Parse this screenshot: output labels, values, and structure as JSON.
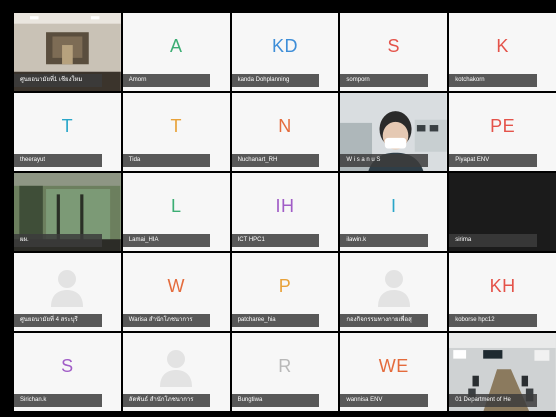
{
  "participants": [
    {
      "name": "ศูนยอนามัยที่1 เชียงใหม",
      "initials": "",
      "color": "",
      "kind": "video-room"
    },
    {
      "name": "Amorn",
      "initials": "A",
      "color": "#3cae74",
      "kind": "initials"
    },
    {
      "name": "kanda Dohplanning",
      "initials": "KD",
      "color": "#3e8ed8",
      "kind": "initials"
    },
    {
      "name": "somporn",
      "initials": "S",
      "color": "#e4534a",
      "kind": "initials"
    },
    {
      "name": "kotchakorn",
      "initials": "K",
      "color": "#e4534a",
      "kind": "initials"
    },
    {
      "name": "theerayut",
      "initials": "T",
      "color": "#2aa6c9",
      "kind": "initials"
    },
    {
      "name": "Tida",
      "initials": "T",
      "color": "#e8a23a",
      "kind": "initials"
    },
    {
      "name": "Nuchanart_RH",
      "initials": "N",
      "color": "#e46b3c",
      "kind": "initials"
    },
    {
      "name": "W i s a n u  S",
      "initials": "",
      "color": "",
      "kind": "video-person"
    },
    {
      "name": "Piyapat ENV",
      "initials": "PE",
      "color": "#e4534a",
      "kind": "initials"
    },
    {
      "name": "ผผ.",
      "initials": "",
      "color": "",
      "kind": "video-corridor"
    },
    {
      "name": "Lamai_HIA",
      "initials": "L",
      "color": "#3cae74",
      "kind": "initials"
    },
    {
      "name": "ICT HPC1",
      "initials": "IH",
      "color": "#a15dc7",
      "kind": "initials"
    },
    {
      "name": "ilawin.k",
      "initials": "I",
      "color": "#2aa6c9",
      "kind": "initials"
    },
    {
      "name": "sirima",
      "initials": "",
      "color": "",
      "kind": "blank"
    },
    {
      "name": "ศูนยอนามัยที่ 4 สระบุรี",
      "initials": "",
      "color": "",
      "kind": "avatar"
    },
    {
      "name": "Warisa สำนักโภชนาการ",
      "initials": "W",
      "color": "#e46b3c",
      "kind": "initials"
    },
    {
      "name": "patcharee_hia",
      "initials": "P",
      "color": "#e8a23a",
      "kind": "initials"
    },
    {
      "name": "กองกิจกรรมทางกายเพื่อสุ",
      "initials": "",
      "color": "",
      "kind": "avatar"
    },
    {
      "name": "koborse hpc12",
      "initials": "KH",
      "color": "#e4534a",
      "kind": "initials"
    },
    {
      "name": "Sirichan.k",
      "initials": "S",
      "color": "#a15dc7",
      "kind": "initials"
    },
    {
      "name": "ลัดพันธ์ สำนักโภชนาการ",
      "initials": "",
      "color": "",
      "kind": "avatar"
    },
    {
      "name": "Bungtiwa",
      "initials": "R",
      "color": "#b8b8b8",
      "kind": "initials"
    },
    {
      "name": "wannisa ENV",
      "initials": "WE",
      "color": "#e46b3c",
      "kind": "initials"
    },
    {
      "name": "01 Department of He",
      "initials": "",
      "color": "",
      "kind": "video-office"
    }
  ]
}
